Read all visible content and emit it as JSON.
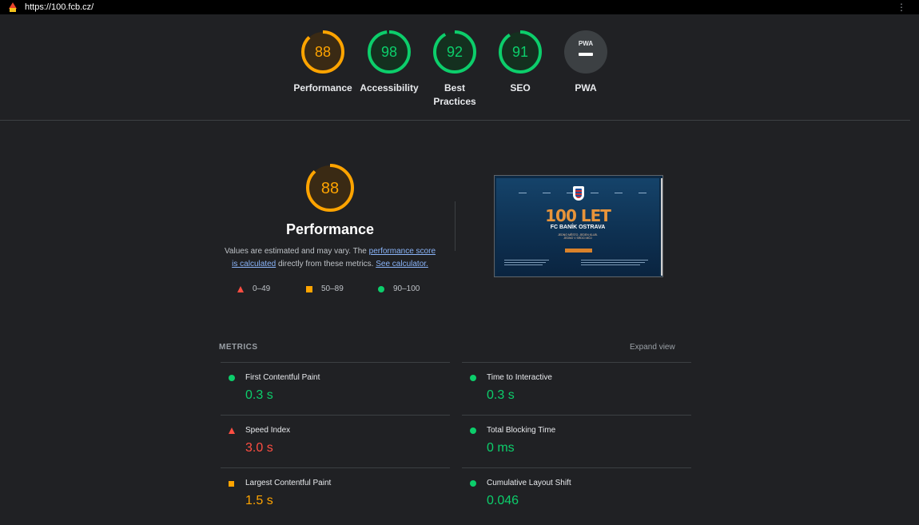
{
  "browser": {
    "url": "https://100.fcb.cz/",
    "menu_icon": "kebab-menu-icon"
  },
  "colors": {
    "fail": "#ff4e42",
    "average": "#ffa400",
    "pass": "#0cce6b",
    "pwa": "#3c4043"
  },
  "summary": {
    "gauges": [
      {
        "score": "88",
        "label": "Performance",
        "status": "average"
      },
      {
        "score": "98",
        "label": "Accessibility",
        "status": "pass"
      },
      {
        "score": "92",
        "label_line1": "Best",
        "label_line2": "Practices",
        "status": "pass"
      },
      {
        "score": "91",
        "label": "SEO",
        "status": "pass"
      },
      {
        "badge_text": "PWA",
        "label": "PWA",
        "status": "pwa"
      }
    ]
  },
  "performance": {
    "score": "88",
    "title": "Performance",
    "desc_part1": "Values are estimated and may vary. The ",
    "link_score": "performance score is calculated",
    "desc_part2": " directly from these metrics. ",
    "link_calc": "See calculator.",
    "legend": [
      {
        "range": "0–49",
        "icon": "triangle-icon"
      },
      {
        "range": "50–89",
        "icon": "square-icon"
      },
      {
        "range": "90–100",
        "icon": "circle-icon"
      }
    ]
  },
  "screenshot": {
    "headline": "100 LET",
    "subtitle": "FC BANÍK OSTRAVA",
    "tagline_1": "JEDNO MĚSTO. JEDEN KLUB.",
    "tagline_2": "JEDNO V SRDCI MŮJ"
  },
  "metrics": {
    "heading": "METRICS",
    "expand_label": "Expand view",
    "items": [
      {
        "title": "First Contentful Paint",
        "value": "0.3 s",
        "status": "pass"
      },
      {
        "title": "Time to Interactive",
        "value": "0.3 s",
        "status": "pass"
      },
      {
        "title": "Speed Index",
        "value": "3.0 s",
        "status": "fail"
      },
      {
        "title": "Total Blocking Time",
        "value": "0 ms",
        "status": "pass"
      },
      {
        "title": "Largest Contentful Paint",
        "value": "1.5 s",
        "status": "average"
      },
      {
        "title": "Cumulative Layout Shift",
        "value": "0.046",
        "status": "pass"
      }
    ]
  }
}
